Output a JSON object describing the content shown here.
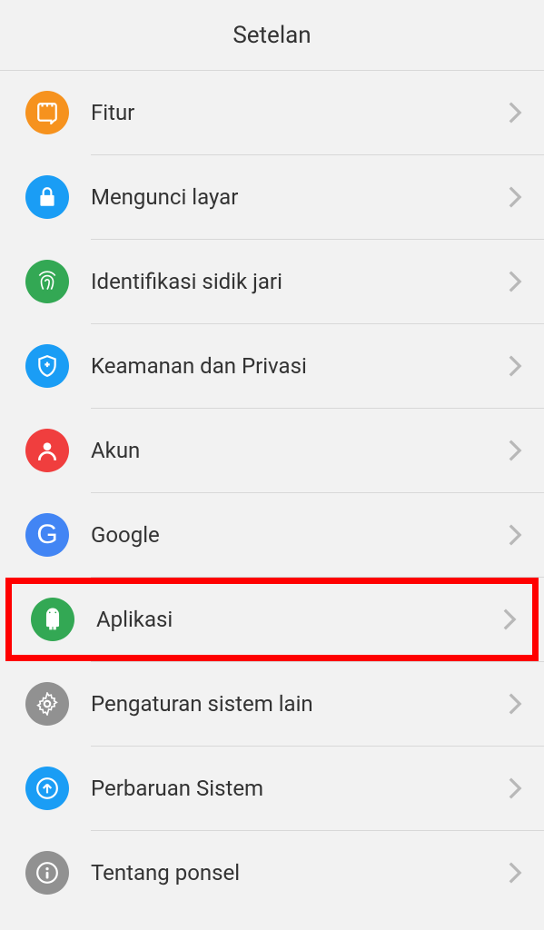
{
  "header": {
    "title": "Setelan"
  },
  "items": [
    {
      "label": "Fitur",
      "icon": "feature-icon",
      "color": "orange"
    },
    {
      "label": "Mengunci layar",
      "icon": "lock-icon",
      "color": "blue"
    },
    {
      "label": "Identifikasi sidik jari",
      "icon": "fingerprint-icon",
      "color": "green"
    },
    {
      "label": "Keamanan dan Privasi",
      "icon": "shield-icon",
      "color": "blue2"
    },
    {
      "label": "Akun",
      "icon": "account-icon",
      "color": "red"
    },
    {
      "label": "Google",
      "icon": "google-icon",
      "color": "gblue"
    },
    {
      "label": "Aplikasi",
      "icon": "android-icon",
      "color": "green2",
      "highlighted": true
    },
    {
      "label": "Pengaturan sistem lain",
      "icon": "gear-icon",
      "color": "gray"
    },
    {
      "label": "Perbaruan Sistem",
      "icon": "update-icon",
      "color": "blue3"
    },
    {
      "label": "Tentang ponsel",
      "icon": "info-icon",
      "color": "gray2"
    }
  ]
}
